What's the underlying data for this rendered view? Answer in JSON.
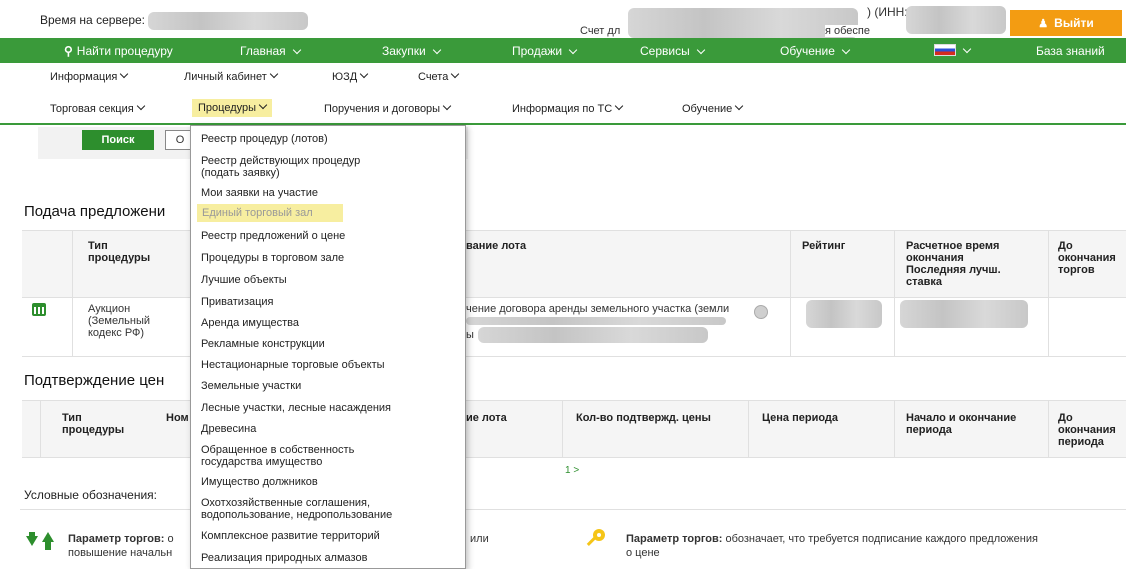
{
  "topbar": {
    "server_time_label": "Время на сервере:",
    "account_prefix": "Счет дл",
    "account_suffix": "я обеспе",
    "inn_label": ") (ИНН:",
    "logout_label": "Выйти",
    "logout_color": "#f39c12"
  },
  "main_nav": {
    "color": "#3a9a3a",
    "items": [
      {
        "label": "Найти процедуру"
      },
      {
        "label": "Главная"
      },
      {
        "label": "Закупки"
      },
      {
        "label": "Продажи"
      },
      {
        "label": "Сервисы"
      },
      {
        "label": "Обучение"
      },
      {
        "label": "База знаний"
      }
    ]
  },
  "sub_nav1": {
    "items": [
      {
        "label": "Информация"
      },
      {
        "label": "Личный кабинет"
      },
      {
        "label": "ЮЗД"
      },
      {
        "label": "Счета"
      }
    ]
  },
  "sub_nav2": {
    "items": [
      {
        "label": "Торговая секция"
      },
      {
        "label": "Процедуры"
      },
      {
        "label": "Поручения и договоры"
      },
      {
        "label": "Информация по ТС"
      },
      {
        "label": "Обучение"
      }
    ]
  },
  "filter": {
    "search_label": "Поиск",
    "reset_label": "О"
  },
  "section1": {
    "title": "Подача предложени",
    "headers": {
      "type": "Тип процедуры",
      "lot": "вание лота",
      "rating": "Рейтинг",
      "calc_time": "Расчетное время окончания Последняя лучш. ставка",
      "until": "До окончания торгов"
    },
    "row": {
      "type": "Аукцион (Земельный кодекс РФ)",
      "lot_line1": "чение договора аренды земельного участка (земли",
      "lot_line2": "ы"
    }
  },
  "section2": {
    "title": "Подтверждение цен",
    "headers": {
      "type": "Тип процедуры",
      "num": "Ном",
      "lot": "ие лота",
      "count": "Кол-во подтвержд. цены",
      "price": "Цена периода",
      "period": "Начало и окончание периода",
      "until": "До окончания периода"
    },
    "pager": "1 >"
  },
  "legend": {
    "title": "Условные обозначения:",
    "item1_bold": "Параметр торгов:",
    "item1_text": " о",
    "item1_line2": "повышение начальн",
    "item1_tail": "или",
    "item2_bold": "Параметр торгов:",
    "item2_text": " обозначает, что требуется подписание каждого предложения",
    "item2_line2": "о цене"
  },
  "dropdown": {
    "items": [
      {
        "label": "Реестр процедур (лотов)"
      },
      {
        "label": "Реестр действующих процедур (подать заявку)"
      },
      {
        "label": "Мои заявки на участие"
      },
      {
        "label": "Единый торговый зал"
      },
      {
        "label": "Реестр предложений о цене"
      },
      {
        "label": "Процедуры в торговом зале"
      },
      {
        "label": "Лучшие объекты"
      },
      {
        "label": "Приватизация"
      },
      {
        "label": "Аренда имущества"
      },
      {
        "label": "Рекламные конструкции"
      },
      {
        "label": "Нестационарные торговые объекты"
      },
      {
        "label": "Земельные участки"
      },
      {
        "label": "Лесные участки, лесные насаждения"
      },
      {
        "label": "Древесина"
      },
      {
        "label": "Обращенное в собственность государства имущество"
      },
      {
        "label": "Имущество должников"
      },
      {
        "label": "Охотхозяйственные соглашения, водопользование, недропользование"
      },
      {
        "label": "Комплексное развитие территорий"
      },
      {
        "label": "Реализация природных алмазов"
      }
    ]
  }
}
